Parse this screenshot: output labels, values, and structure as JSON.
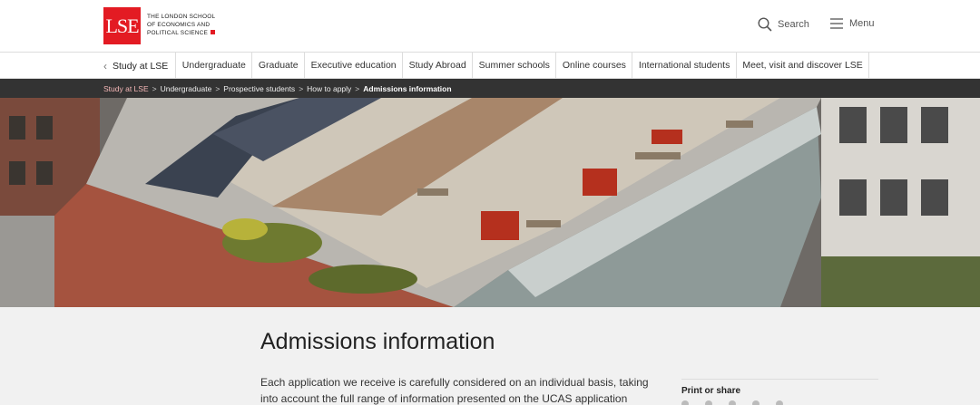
{
  "header": {
    "logo_mark": "LSE",
    "logo_lines": [
      "THE LONDON SCHOOL",
      "OF ECONOMICS AND",
      "POLITICAL SCIENCE"
    ],
    "search_label": "Search",
    "menu_label": "Menu"
  },
  "nav": {
    "back_label": "Study at LSE",
    "items": [
      "Undergraduate",
      "Graduate",
      "Executive education",
      "Study Abroad",
      "Summer schools",
      "Online courses",
      "International students",
      "Meet, visit and discover LSE"
    ]
  },
  "breadcrumb": {
    "items": [
      "Study at LSE",
      "Undergraduate",
      "Prospective students",
      "How to apply"
    ],
    "current": "Admissions information"
  },
  "page": {
    "title": "Admissions information",
    "intro": "Each application we receive is carefully considered on an individual basis, taking into account the full range of information presented on the UCAS application form.",
    "print_label": "Print or share"
  },
  "colors": {
    "brand_red": "#e31b23",
    "breadcrumb_bg": "#333333",
    "breadcrumb_link": "#f4b6b6"
  },
  "icons": {
    "search": "search-icon",
    "menu": "hamburger-icon",
    "back": "chevron-left-icon"
  }
}
